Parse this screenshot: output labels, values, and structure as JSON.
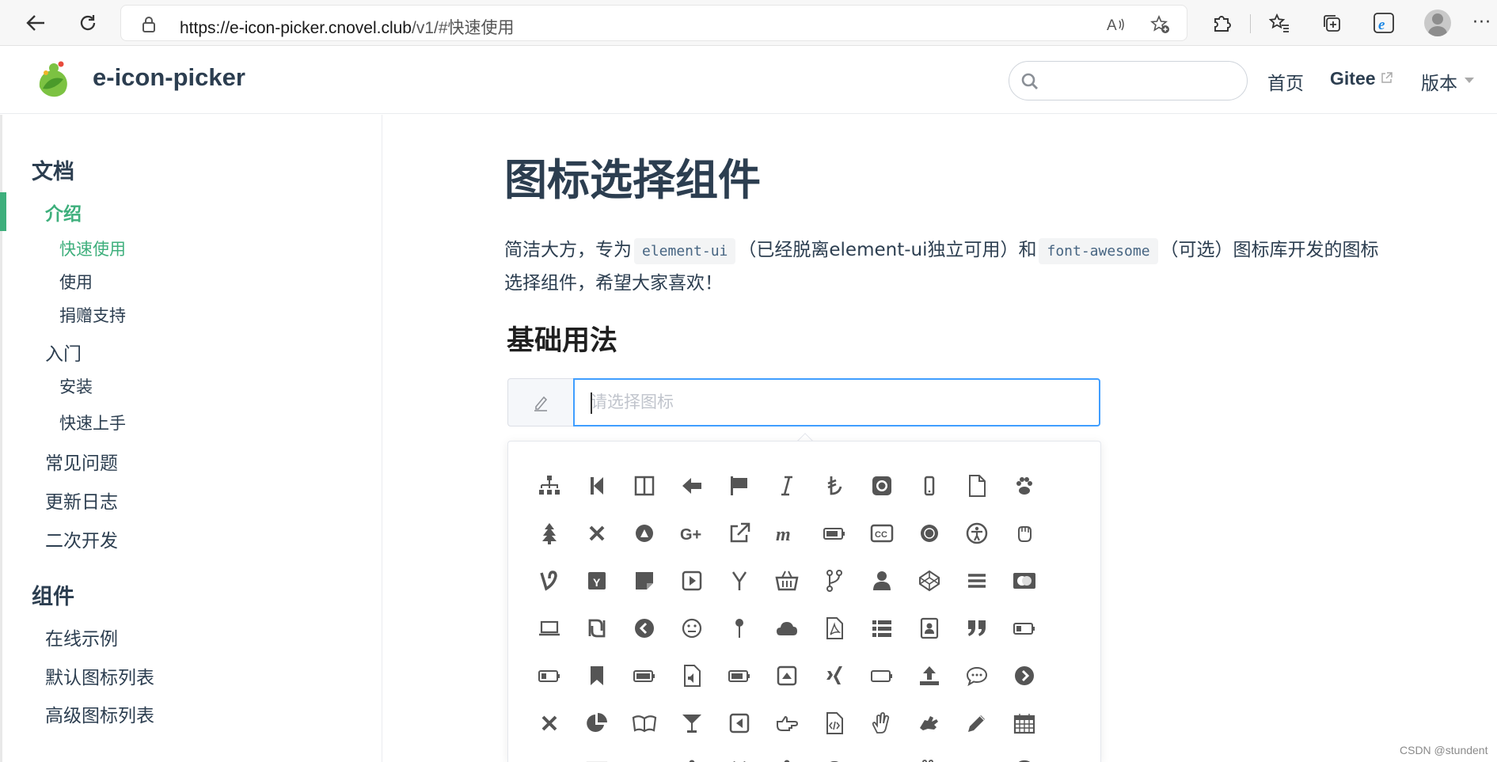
{
  "browser": {
    "url_host": "https://e-icon-picker.cnovel.club",
    "url_path": "/v1/#快速使用"
  },
  "site": {
    "title": "e-icon-picker",
    "search": {
      "placeholder": "",
      "value": ""
    },
    "nav": {
      "home": "首页",
      "gitee": "Gitee",
      "version": "版本"
    }
  },
  "sidebar": {
    "section_docs": "文档",
    "intro": "介绍",
    "quick_use": "快速使用",
    "usage": "使用",
    "donate": "捐赠支持",
    "getting_started": "入门",
    "install": "安装",
    "quick_start": "快速上手",
    "faq": "常见问题",
    "changelog": "更新日志",
    "secondary_dev": "二次开发",
    "section_components": "组件",
    "online_examples": "在线示例",
    "default_icons": "默认图标列表",
    "advanced_icons": "高级图标列表"
  },
  "main": {
    "title": "图标选择组件",
    "intro_part1": "简洁大方，专为",
    "code1": "element-ui",
    "intro_part2": "（已经脱离element-ui独立可用）和",
    "code2": "font-awesome",
    "intro_part3": "（可选）图标库开发的图标选择组件，希望大家喜欢！",
    "section_basic": "基础用法",
    "picker": {
      "placeholder": "请选择图标",
      "value": ""
    }
  },
  "icons": [
    "sitemap",
    "step-backward",
    "columns",
    "arrow-left",
    "flag",
    "italic",
    "turkish-lira",
    "github-square",
    "mobile",
    "file-o",
    "paw",
    "tree",
    "times",
    "artstation",
    "google-plus",
    "external-link",
    "meanpath",
    "battery-three-quarters",
    "cc",
    "first-order",
    "universal-access",
    "hand-rock-o",
    "vine",
    "y-combinator-square",
    "sticky-note",
    "play-square-o",
    "y-combinator",
    "shopping-basket",
    "code-fork",
    "user",
    "codepen",
    "bars",
    "cc-mastercard",
    "laptop",
    "shekel",
    "chevron-circle-left",
    "meh-o",
    "map-pin",
    "cloud",
    "file-pdf-o",
    "list",
    "address-book",
    "quote-right",
    "battery-quarter",
    "battery-quarter-2",
    "bookmark",
    "battery-full",
    "file-audio-o",
    "battery-three-quarters-2",
    "caret-square-o-up",
    "xing",
    "battery-empty",
    "upload",
    "commenting-o",
    "chevron-circle-right",
    "times-2",
    "pie-chart",
    "leanpub",
    "glass",
    "caret-square-o-left",
    "hand-o-right",
    "file-code-o",
    "hand-spock-o",
    "sign-language",
    "pencil",
    "calendar",
    "filter",
    "table",
    "minus",
    "male",
    "github-alt",
    "female",
    "clock-o",
    "asl",
    "hand-peace",
    "code",
    "chrome"
  ],
  "watermark": "CSDN @stundent"
}
